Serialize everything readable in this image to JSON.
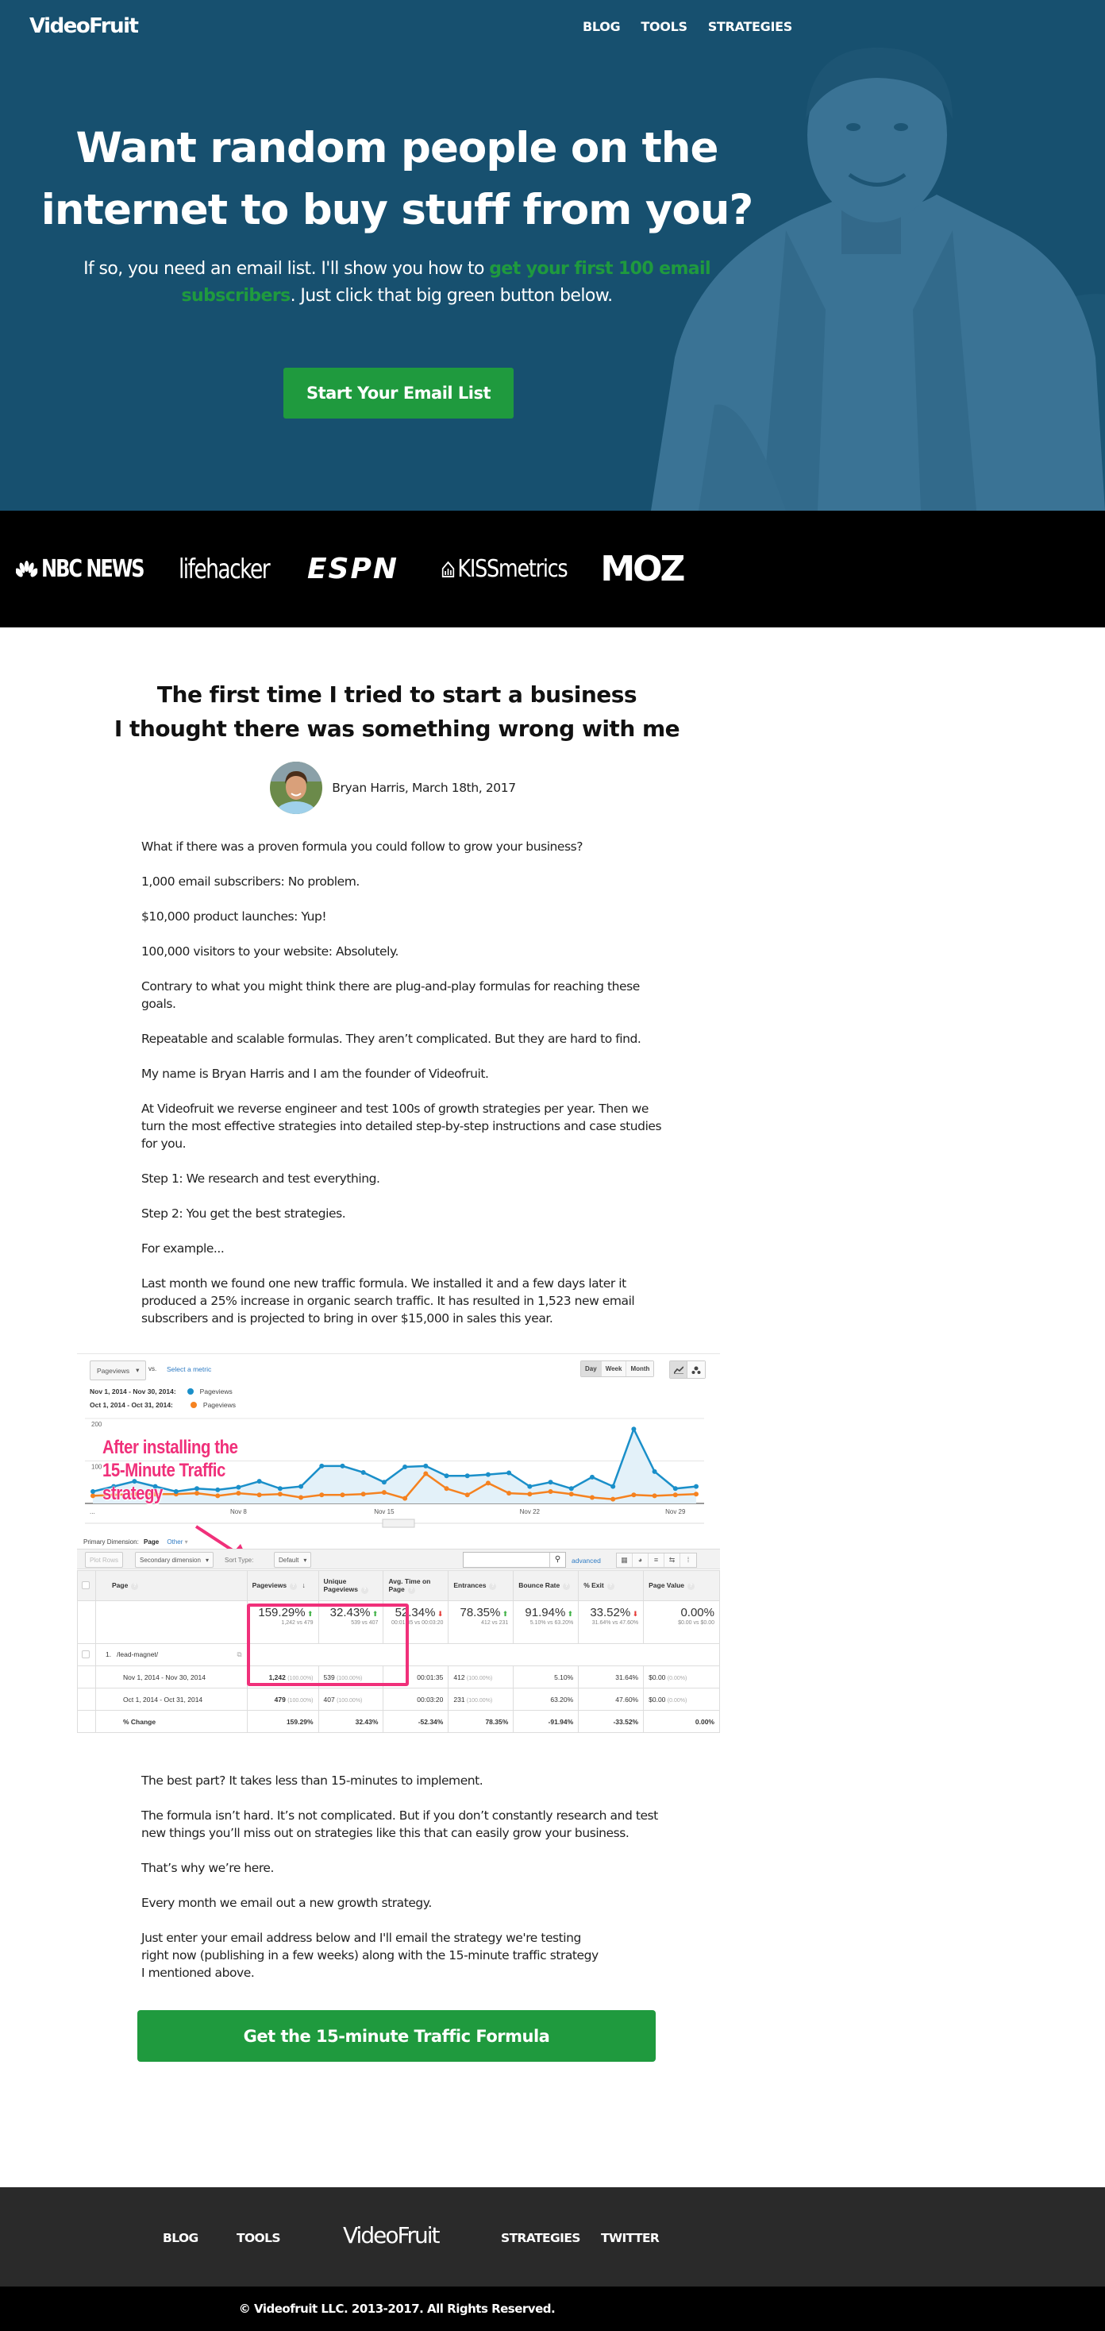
{
  "brand": {
    "name": "VideoFruit",
    "accent_green": "#1f9a3e",
    "hero_blue": "#17506f",
    "annotation_pink": "#f0307a"
  },
  "nav": {
    "items": [
      "BLOG",
      "TOOLS",
      "STRATEGIES"
    ]
  },
  "hero": {
    "title_line1": "Want random people on the",
    "title_line2": "internet to buy stuff from you?",
    "subtitle_pre": "If so, you need an email list. I'll show you how to ",
    "subtitle_highlight": "get your first 100 email subscribers",
    "subtitle_post": ". Just click that big green button below.",
    "cta_label": "Start Your Email List"
  },
  "press": {
    "logos": [
      "NBC NEWS",
      "lifehacker",
      "ESPN",
      "KISSmetrics",
      "MOZ"
    ]
  },
  "article": {
    "title_line1": "The first time I tried to start a business",
    "title_line2": "I thought there was something wrong with me",
    "byline": "Bryan Harris, March 18th, 2017",
    "paragraphs_before": [
      "What if there was a proven formula you could follow to grow your business?",
      "1,000 email subscribers: No problem.",
      "$10,000 product launches: Yup!",
      "100,000 visitors to your website: Absolutely.",
      "Contrary to what you might think there are plug-and-play formulas for reaching these goals.",
      "Repeatable and scalable formulas. They aren’t complicated. But they are hard to find.",
      "My name is Bryan Harris and I am the founder of Videofruit.",
      "At Videofruit we reverse engineer and test 100s of growth strategies per year. Then we turn the most effective strategies into detailed step-by-step instructions and case studies for you.",
      "Step 1: We research and test everything.",
      "Step 2: You get the best strategies.",
      "For example...",
      "Last month we found one new traffic formula. We installed it and a few days later it produced a 25% increase in organic search traffic. It has resulted in 1,523 new email subscribers and is projected to bring in over $15,000 in sales this year."
    ],
    "paragraphs_after": [
      "The best part? It takes less than 15-minutes to implement.",
      "The formula isn’t hard. It’s not complicated. But if you don’t constantly research and test new things you’ll miss out on strategies like this that can easily grow your business.",
      "That’s why we’re here.",
      "Every month we email out a new growth strategy.",
      "Just enter your email address below and I'll email the strategy we're testing right now (publishing in a few weeks) along with the 15-minute traffic strategy I mentioned above."
    ],
    "cta_label": "Get the 15-minute Traffic Formula"
  },
  "analytics": {
    "metric_select": "Pageviews",
    "vs_label": "vs.",
    "select_metric_link": "Select a metric",
    "legend": [
      {
        "range": "Nov 1, 2014 - Nov 30, 2014:",
        "metric": "Pageviews",
        "color": "#1a8fc9"
      },
      {
        "range": "Oct 1, 2014 - Oct 31, 2014:",
        "metric": "Pageviews",
        "color": "#f58220"
      }
    ],
    "time_buttons": [
      "Day",
      "Week",
      "Month"
    ],
    "time_active": "Day",
    "annotation": [
      "After installing the",
      "15-Minute Traffic",
      "strategy"
    ],
    "primary_dimension_label": "Primary Dimension:",
    "primary_dimension_value": "Page",
    "other_label": "Other",
    "toolbar": {
      "plot_rows": "Plot Rows",
      "secondary_dimension": "Secondary dimension",
      "sort_type_label": "Sort Type:",
      "sort_type_value": "Default",
      "advanced": "advanced"
    },
    "columns": [
      "Page",
      "Pageviews",
      "Unique Pageviews",
      "Avg. Time on Page",
      "Entrances",
      "Bounce Rate",
      "% Exit",
      "Page Value"
    ],
    "summary": [
      {
        "value": "159.29%",
        "dir": "up",
        "detail": "1,242 vs 479"
      },
      {
        "value": "32.43%",
        "dir": "up",
        "detail": "539 vs 407"
      },
      {
        "value": "52.34%",
        "dir": "down",
        "detail": "00:01:35 vs 00:03:20"
      },
      {
        "value": "78.35%",
        "dir": "up",
        "detail": "412 vs 231"
      },
      {
        "value": "91.94%",
        "dir": "up",
        "detail": "5.10% vs 63.20%"
      },
      {
        "value": "33.52%",
        "dir": "down",
        "detail": "31.64% vs 47.60%"
      },
      {
        "value": "0.00%",
        "dir": "none",
        "detail": "$0.00 vs $0.00"
      }
    ],
    "page_row": {
      "index": "1.",
      "page": "/lead-magnet/"
    },
    "rows": [
      {
        "label": "Nov 1, 2014 - Nov 30, 2014",
        "cells": [
          "1,242",
          "539",
          "00:01:35",
          "412",
          "5.10%",
          "31.64%",
          "$0.00"
        ],
        "pcts": [
          "(100.00%)",
          "(100.00%)",
          "",
          "(100.00%)",
          "",
          "",
          "(0.00%)"
        ]
      },
      {
        "label": "Oct 1, 2014 - Oct 31, 2014",
        "cells": [
          "479",
          "407",
          "00:03:20",
          "231",
          "63.20%",
          "47.60%",
          "$0.00"
        ],
        "pcts": [
          "(100.00%)",
          "(100.00%)",
          "",
          "(100.00%)",
          "",
          "",
          "(0.00%)"
        ]
      },
      {
        "label": "% Change",
        "cells": [
          "159.29%",
          "32.43%",
          "-52.34%",
          "78.35%",
          "-91.94%",
          "-33.52%",
          "0.00%"
        ],
        "pcts": [
          "",
          "",
          "",
          "",
          "",
          "",
          ""
        ]
      }
    ]
  },
  "chart_data": {
    "type": "line",
    "title": "",
    "xlabel": "",
    "ylabel": "Pageviews",
    "ylim": [
      0,
      200
    ],
    "yticks": [
      "200",
      "100"
    ],
    "xtick_labels": [
      "...",
      "Nov 8",
      "Nov 15",
      "Nov 22",
      "Nov 29"
    ],
    "x": [
      1,
      2,
      3,
      4,
      5,
      6,
      7,
      8,
      9,
      10,
      11,
      12,
      13,
      14,
      15,
      16,
      17,
      18,
      19,
      20,
      21,
      22,
      23,
      24,
      25,
      26,
      27,
      28,
      29,
      30
    ],
    "series": [
      {
        "name": "Nov 1, 2014 - Nov 30, 2014: Pageviews",
        "color": "#1a8fc9",
        "fill": true,
        "values": [
          28,
          40,
          52,
          40,
          28,
          35,
          32,
          38,
          52,
          35,
          40,
          88,
          88,
          73,
          50,
          86,
          88,
          65,
          65,
          68,
          72,
          40,
          50,
          35,
          62,
          40,
          175,
          75,
          35,
          40
        ]
      },
      {
        "name": "Oct 1, 2014 - Oct 31, 2014: Pageviews",
        "color": "#f58220",
        "fill": false,
        "values": [
          18,
          20,
          22,
          22,
          22,
          24,
          18,
          24,
          20,
          22,
          14,
          20,
          20,
          22,
          26,
          12,
          70,
          35,
          20,
          48,
          24,
          22,
          28,
          22,
          14,
          10,
          20,
          18,
          20,
          22
        ]
      }
    ],
    "grid": true,
    "legend": "top-left"
  },
  "footer": {
    "links_left": [
      "BLOG",
      "TOOLS"
    ],
    "logo": "VideoFruit",
    "links_right": [
      "STRATEGIES",
      "TWITTER"
    ],
    "copyright": "© Videofruit LLC. 2013-2017. All Rights Reserved."
  }
}
